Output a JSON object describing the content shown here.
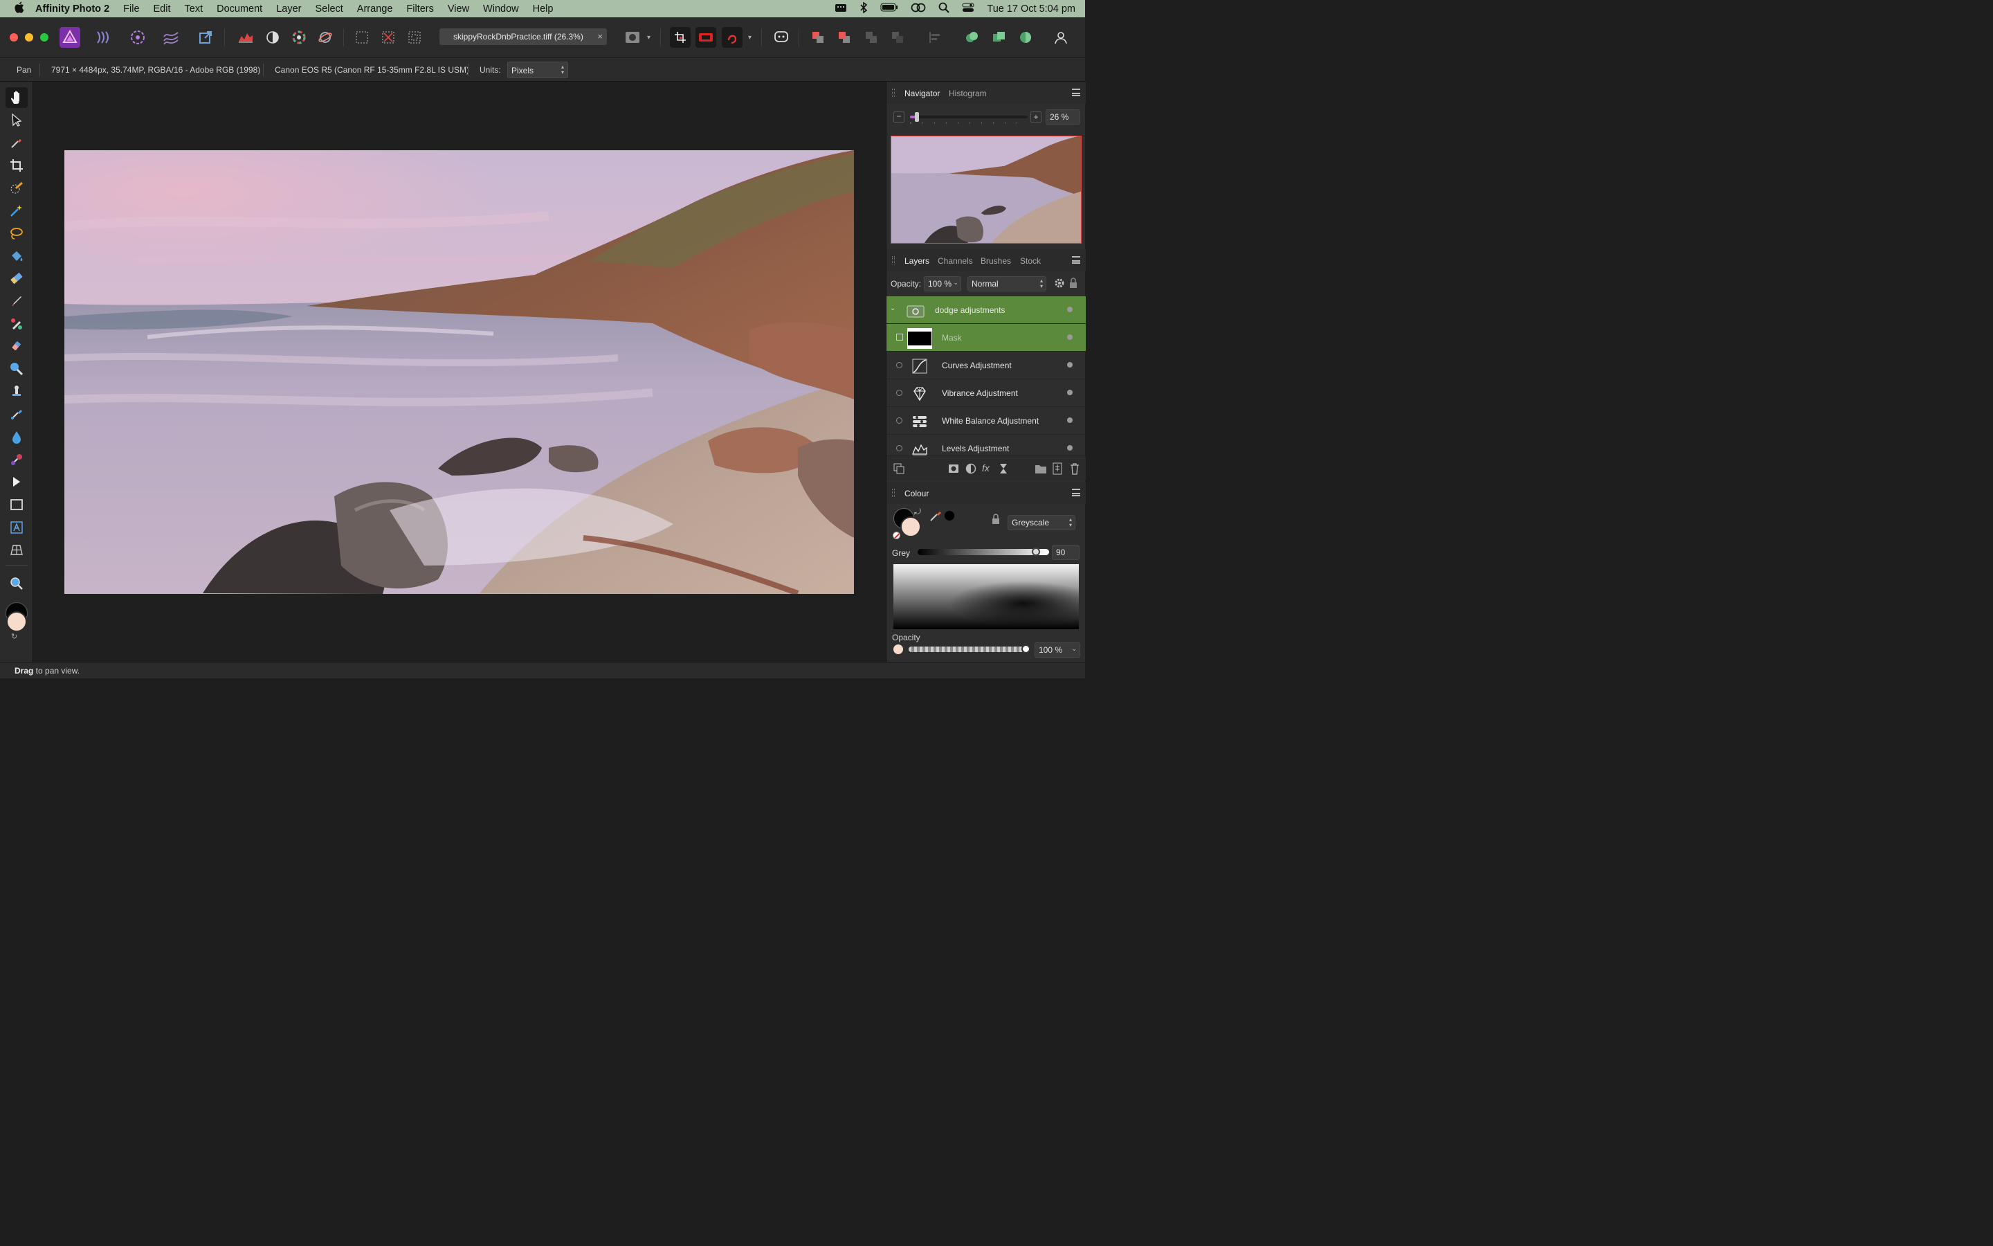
{
  "menubar": {
    "app_name": "Affinity Photo 2",
    "items": [
      "File",
      "Edit",
      "Text",
      "Document",
      "Layer",
      "Select",
      "Arrange",
      "Filters",
      "View",
      "Window",
      "Help"
    ],
    "clock": "Tue 17 Oct  5:04 pm"
  },
  "toolbar": {
    "document_tab": "skippyRockDnbPractice.tiff (26.3%)",
    "document_close": "×"
  },
  "context": {
    "tool_name": "Pan",
    "image_info": "7971 × 4484px, 35.74MP, RGBA/16 - Adobe RGB (1998)",
    "camera_info": "Canon EOS R5 (Canon RF 15-35mm F2.8L IS USM)",
    "units_label": "Units:",
    "units_value": "Pixels"
  },
  "navigator": {
    "tabs": [
      "Navigator",
      "Histogram"
    ],
    "zoom_value": "26 %",
    "zoom_fraction": 0.06
  },
  "layers_panel": {
    "tabs": [
      "Layers",
      "Channels",
      "Brushes",
      "Stock"
    ],
    "opacity_label": "Opacity:",
    "opacity_value": "100 %",
    "blend_mode": "Normal",
    "layers": [
      {
        "name": "dodge adjustments",
        "type": "group",
        "selected": true
      },
      {
        "name": "Mask",
        "type": "mask",
        "selected": true
      },
      {
        "name": "Curves Adjustment",
        "type": "curves"
      },
      {
        "name": "Vibrance Adjustment",
        "type": "vibrance"
      },
      {
        "name": "White Balance Adjustment",
        "type": "white-balance"
      },
      {
        "name": "Levels Adjustment",
        "type": "levels"
      }
    ]
  },
  "colour_panel": {
    "title": "Colour",
    "model": "Greyscale",
    "grey_label": "Grey",
    "grey_value": "90",
    "grey_fraction": 0.9,
    "opacity_label": "Opacity",
    "opacity_value": "100 %"
  },
  "statusbar": {
    "bold": "Drag",
    "text": " to pan view."
  },
  "colors": {
    "menubar_bg": "#a9bfa8",
    "selected_layer": "#5c8a3c",
    "accent_magenta": "#c85fe0",
    "secondary_colour": "#f8dccb"
  }
}
